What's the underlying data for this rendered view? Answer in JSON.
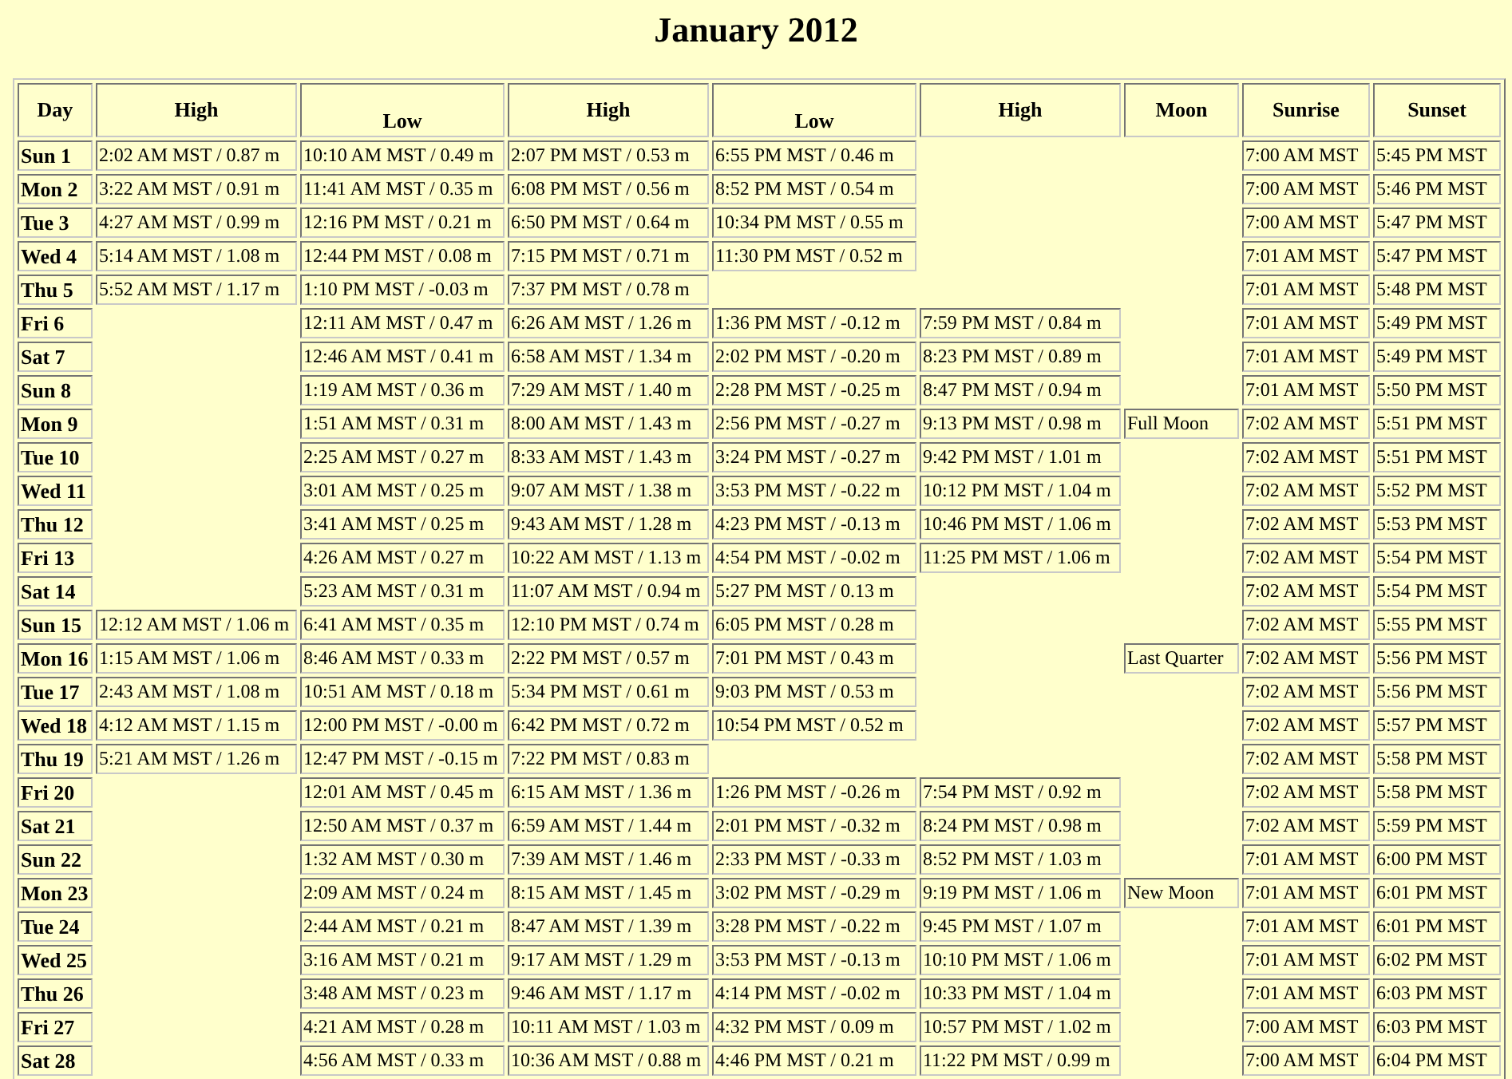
{
  "title": "January 2012",
  "columns": [
    {
      "label": "Day",
      "kind": "day"
    },
    {
      "label": "High",
      "kind": "high"
    },
    {
      "label": "Low",
      "kind": "low"
    },
    {
      "label": "High",
      "kind": "high"
    },
    {
      "label": "Low",
      "kind": "low"
    },
    {
      "label": "High",
      "kind": "high"
    },
    {
      "label": "Moon",
      "kind": "moon"
    },
    {
      "label": "Sunrise",
      "kind": "sunrise"
    },
    {
      "label": "Sunset",
      "kind": "sunset"
    }
  ],
  "rows": [
    {
      "day": "Sun 1",
      "cells": [
        "2:02 AM MST / 0.87 m",
        "10:10 AM MST / 0.49 m",
        "2:07 PM MST / 0.53 m",
        "6:55 PM MST / 0.46 m",
        null,
        null,
        "7:00 AM MST",
        "5:45 PM MST"
      ]
    },
    {
      "day": "Mon 2",
      "cells": [
        "3:22 AM MST / 0.91 m",
        "11:41 AM MST / 0.35 m",
        "6:08 PM MST / 0.56 m",
        "8:52 PM MST / 0.54 m",
        null,
        null,
        "7:00 AM MST",
        "5:46 PM MST"
      ]
    },
    {
      "day": "Tue 3",
      "cells": [
        "4:27 AM MST / 0.99 m",
        "12:16 PM MST / 0.21 m",
        "6:50 PM MST / 0.64 m",
        "10:34 PM MST / 0.55 m",
        null,
        null,
        "7:00 AM MST",
        "5:47 PM MST"
      ]
    },
    {
      "day": "Wed 4",
      "cells": [
        "5:14 AM MST / 1.08 m",
        "12:44 PM MST / 0.08 m",
        "7:15 PM MST / 0.71 m",
        "11:30 PM MST / 0.52 m",
        null,
        null,
        "7:01 AM MST",
        "5:47 PM MST"
      ]
    },
    {
      "day": "Thu 5",
      "cells": [
        "5:52 AM MST / 1.17 m",
        "1:10 PM MST / -0.03 m",
        "7:37 PM MST / 0.78 m",
        null,
        null,
        null,
        "7:01 AM MST",
        "5:48 PM MST"
      ]
    },
    {
      "day": "Fri 6",
      "cells": [
        null,
        "12:11 AM MST / 0.47 m",
        "6:26 AM MST / 1.26 m",
        "1:36 PM MST / -0.12 m",
        "7:59 PM MST / 0.84 m",
        null,
        "7:01 AM MST",
        "5:49 PM MST"
      ]
    },
    {
      "day": "Sat 7",
      "cells": [
        null,
        "12:46 AM MST / 0.41 m",
        "6:58 AM MST / 1.34 m",
        "2:02 PM MST / -0.20 m",
        "8:23 PM MST / 0.89 m",
        null,
        "7:01 AM MST",
        "5:49 PM MST"
      ]
    },
    {
      "day": "Sun 8",
      "cells": [
        null,
        "1:19 AM MST / 0.36 m",
        "7:29 AM MST / 1.40 m",
        "2:28 PM MST / -0.25 m",
        "8:47 PM MST / 0.94 m",
        null,
        "7:01 AM MST",
        "5:50 PM MST"
      ]
    },
    {
      "day": "Mon 9",
      "cells": [
        null,
        "1:51 AM MST / 0.31 m",
        "8:00 AM MST / 1.43 m",
        "2:56 PM MST / -0.27 m",
        "9:13 PM MST / 0.98 m",
        "Full Moon",
        "7:02 AM MST",
        "5:51 PM MST"
      ]
    },
    {
      "day": "Tue 10",
      "cells": [
        null,
        "2:25 AM MST / 0.27 m",
        "8:33 AM MST / 1.43 m",
        "3:24 PM MST / -0.27 m",
        "9:42 PM MST / 1.01 m",
        null,
        "7:02 AM MST",
        "5:51 PM MST"
      ]
    },
    {
      "day": "Wed 11",
      "cells": [
        null,
        "3:01 AM MST / 0.25 m",
        "9:07 AM MST / 1.38 m",
        "3:53 PM MST / -0.22 m",
        "10:12 PM MST / 1.04 m",
        null,
        "7:02 AM MST",
        "5:52 PM MST"
      ]
    },
    {
      "day": "Thu 12",
      "cells": [
        null,
        "3:41 AM MST / 0.25 m",
        "9:43 AM MST / 1.28 m",
        "4:23 PM MST / -0.13 m",
        "10:46 PM MST / 1.06 m",
        null,
        "7:02 AM MST",
        "5:53 PM MST"
      ]
    },
    {
      "day": "Fri 13",
      "cells": [
        null,
        "4:26 AM MST / 0.27 m",
        "10:22 AM MST / 1.13 m",
        "4:54 PM MST / -0.02 m",
        "11:25 PM MST / 1.06 m",
        null,
        "7:02 AM MST",
        "5:54 PM MST"
      ]
    },
    {
      "day": "Sat 14",
      "cells": [
        null,
        "5:23 AM MST / 0.31 m",
        "11:07 AM MST / 0.94 m",
        "5:27 PM MST / 0.13 m",
        null,
        null,
        "7:02 AM MST",
        "5:54 PM MST"
      ]
    },
    {
      "day": "Sun 15",
      "cells": [
        "12:12 AM MST / 1.06 m",
        "6:41 AM MST / 0.35 m",
        "12:10 PM MST / 0.74 m",
        "6:05 PM MST / 0.28 m",
        null,
        null,
        "7:02 AM MST",
        "5:55 PM MST"
      ]
    },
    {
      "day": "Mon 16",
      "cells": [
        "1:15 AM MST / 1.06 m",
        "8:46 AM MST / 0.33 m",
        "2:22 PM MST / 0.57 m",
        "7:01 PM MST / 0.43 m",
        null,
        "Last Quarter",
        "7:02 AM MST",
        "5:56 PM MST"
      ]
    },
    {
      "day": "Tue 17",
      "cells": [
        "2:43 AM MST / 1.08 m",
        "10:51 AM MST / 0.18 m",
        "5:34 PM MST / 0.61 m",
        "9:03 PM MST / 0.53 m",
        null,
        null,
        "7:02 AM MST",
        "5:56 PM MST"
      ]
    },
    {
      "day": "Wed 18",
      "cells": [
        "4:12 AM MST / 1.15 m",
        "12:00 PM MST / -0.00 m",
        "6:42 PM MST / 0.72 m",
        "10:54 PM MST / 0.52 m",
        null,
        null,
        "7:02 AM MST",
        "5:57 PM MST"
      ]
    },
    {
      "day": "Thu 19",
      "cells": [
        "5:21 AM MST / 1.26 m",
        "12:47 PM MST / -0.15 m",
        "7:22 PM MST / 0.83 m",
        null,
        null,
        null,
        "7:02 AM MST",
        "5:58 PM MST"
      ]
    },
    {
      "day": "Fri 20",
      "cells": [
        null,
        "12:01 AM MST / 0.45 m",
        "6:15 AM MST / 1.36 m",
        "1:26 PM MST / -0.26 m",
        "7:54 PM MST / 0.92 m",
        null,
        "7:02 AM MST",
        "5:58 PM MST"
      ]
    },
    {
      "day": "Sat 21",
      "cells": [
        null,
        "12:50 AM MST / 0.37 m",
        "6:59 AM MST / 1.44 m",
        "2:01 PM MST / -0.32 m",
        "8:24 PM MST / 0.98 m",
        null,
        "7:02 AM MST",
        "5:59 PM MST"
      ]
    },
    {
      "day": "Sun 22",
      "cells": [
        null,
        "1:32 AM MST / 0.30 m",
        "7:39 AM MST / 1.46 m",
        "2:33 PM MST / -0.33 m",
        "8:52 PM MST / 1.03 m",
        null,
        "7:01 AM MST",
        "6:00 PM MST"
      ]
    },
    {
      "day": "Mon 23",
      "cells": [
        null,
        "2:09 AM MST / 0.24 m",
        "8:15 AM MST / 1.45 m",
        "3:02 PM MST / -0.29 m",
        "9:19 PM MST / 1.06 m",
        "New Moon",
        "7:01 AM MST",
        "6:01 PM MST"
      ]
    },
    {
      "day": "Tue 24",
      "cells": [
        null,
        "2:44 AM MST / 0.21 m",
        "8:47 AM MST / 1.39 m",
        "3:28 PM MST / -0.22 m",
        "9:45 PM MST / 1.07 m",
        null,
        "7:01 AM MST",
        "6:01 PM MST"
      ]
    },
    {
      "day": "Wed 25",
      "cells": [
        null,
        "3:16 AM MST / 0.21 m",
        "9:17 AM MST / 1.29 m",
        "3:53 PM MST / -0.13 m",
        "10:10 PM MST / 1.06 m",
        null,
        "7:01 AM MST",
        "6:02 PM MST"
      ]
    },
    {
      "day": "Thu 26",
      "cells": [
        null,
        "3:48 AM MST / 0.23 m",
        "9:46 AM MST / 1.17 m",
        "4:14 PM MST / -0.02 m",
        "10:33 PM MST / 1.04 m",
        null,
        "7:01 AM MST",
        "6:03 PM MST"
      ]
    },
    {
      "day": "Fri 27",
      "cells": [
        null,
        "4:21 AM MST / 0.28 m",
        "10:11 AM MST / 1.03 m",
        "4:32 PM MST / 0.09 m",
        "10:57 PM MST / 1.02 m",
        null,
        "7:00 AM MST",
        "6:03 PM MST"
      ]
    },
    {
      "day": "Sat 28",
      "cells": [
        null,
        "4:56 AM MST / 0.33 m",
        "10:36 AM MST / 0.88 m",
        "4:46 PM MST / 0.21 m",
        "11:22 PM MST / 0.99 m",
        null,
        "7:00 AM MST",
        "6:04 PM MST"
      ]
    }
  ]
}
